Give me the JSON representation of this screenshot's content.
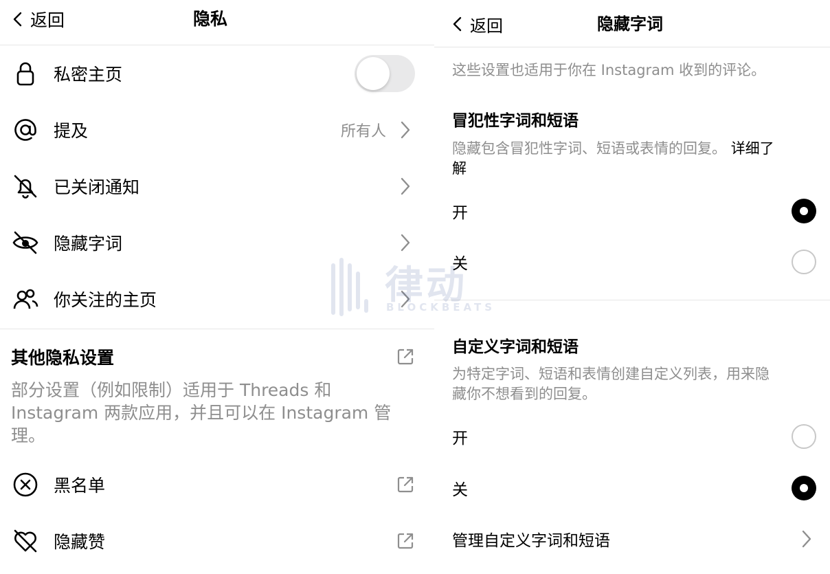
{
  "left": {
    "header": {
      "back_label": "返回",
      "title": "隐私"
    },
    "rows": [
      {
        "label": "私密主页",
        "icon": "lock-icon",
        "control": "toggle",
        "toggle_on": false
      },
      {
        "label": "提及",
        "icon": "at-sign-icon",
        "value": "所有人"
      },
      {
        "label": "已关闭通知",
        "icon": "bell-off-icon"
      },
      {
        "label": "隐藏字词",
        "icon": "eye-off-icon"
      },
      {
        "label": "你关注的主页",
        "icon": "people-icon"
      }
    ],
    "other": {
      "title": "其他隐私设置",
      "desc_line1": "部分设置（例如限制）适用于 Threads 和",
      "desc_line2": "Instagram 两款应用，并且可以在 Instagram 管",
      "desc_line3": "理。",
      "rows": [
        {
          "label": "黑名单",
          "icon": "block-circle-x-icon"
        },
        {
          "label": "隐藏赞",
          "icon": "heart-off-icon"
        }
      ]
    }
  },
  "right": {
    "header": {
      "back_label": "返回",
      "title": "隐藏字词"
    },
    "intro": "这些设置也适用于你在 Instagram 收到的评论。",
    "offensive": {
      "title": "冒犯性字词和短语",
      "desc": "隐藏包含冒犯性字词、短语或表情的回复。",
      "learn_more": "详细了",
      "learn_more_2": "解",
      "options": [
        {
          "label": "开",
          "selected": true
        },
        {
          "label": "关",
          "selected": false
        }
      ]
    },
    "custom": {
      "title": "自定义字词和短语",
      "desc_line1": "为特定字词、短语和表情创建自定义列表，用来隐",
      "desc_line2": "藏你不想看到的回复。",
      "options": [
        {
          "label": "开",
          "selected": false
        },
        {
          "label": "关",
          "selected": true
        }
      ],
      "manage_label": "管理自定义字词和短语"
    }
  },
  "watermark": {
    "text": "律动",
    "sub": "BLOCKBEATS"
  },
  "colors": {
    "accent": "#000000",
    "secondary_text": "#8e8e8e",
    "toggle_off": "#e9e9ea",
    "divider": "#e6e6e6"
  }
}
